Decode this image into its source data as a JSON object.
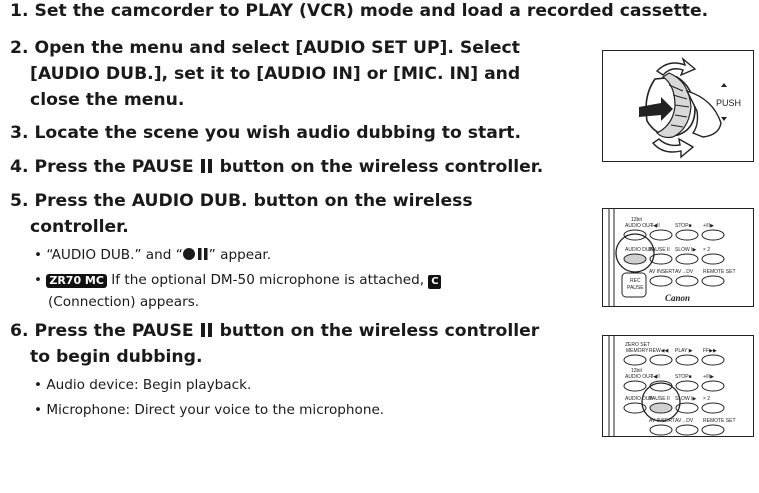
{
  "steps": [
    {
      "num": "1.",
      "text": "Set the camcorder to PLAY (VCR) mode and load a recorded cassette."
    },
    {
      "num": "2.",
      "line1": "Open the menu and select [AUDIO SET UP]. Select",
      "line2": "[AUDIO DUB.], set it to [AUDIO IN] or [MIC. IN] and",
      "line3": "close the menu."
    },
    {
      "num": "3.",
      "text": "Locate the scene you wish audio dubbing to start."
    },
    {
      "num": "4.",
      "text_a": "Press the PAUSE",
      "text_b": "button on the wireless controller."
    },
    {
      "num": "5.",
      "line1": "Press the AUDIO DUB. button on the wireless",
      "line2": "controller."
    },
    {
      "num": "6.",
      "text_a": "Press the PAUSE",
      "text_b": "button on the wireless controller",
      "line2": "to begin dubbing."
    }
  ],
  "step5_bullets": {
    "b1_a": "• “AUDIO DUB.” and “",
    "b1_b": "” appear.",
    "b2_badge": "ZR70 MC",
    "b2_a": "If the optional DM-50 microphone is attached,",
    "b2_icon": "C",
    "b2_line2": "(Connection) appears."
  },
  "step6_bullets": [
    "• Audio device: Begin playback.",
    "• Microphone: Direct your voice to the microphone."
  ],
  "figures": {
    "dial_label": "PUSH",
    "remote_labels": {
      "r1": [
        "12bit",
        "AUDIO OUT",
        "–/◀II",
        "STOP■",
        "+/II▶"
      ],
      "r2": [
        "AUDIO DUB",
        "PAUSE II",
        "SLOW I▶",
        "× 2"
      ],
      "r3": [
        "AV INSERT",
        "AV→DV",
        "REMOTE SET"
      ],
      "rec_pause": [
        "REC",
        "PAUSE"
      ],
      "brand": "Canon",
      "top_row": [
        "ZERO SET",
        "MEMORY",
        "REW◀◀",
        "PLAY ▶",
        "FF▶▶"
      ]
    }
  }
}
